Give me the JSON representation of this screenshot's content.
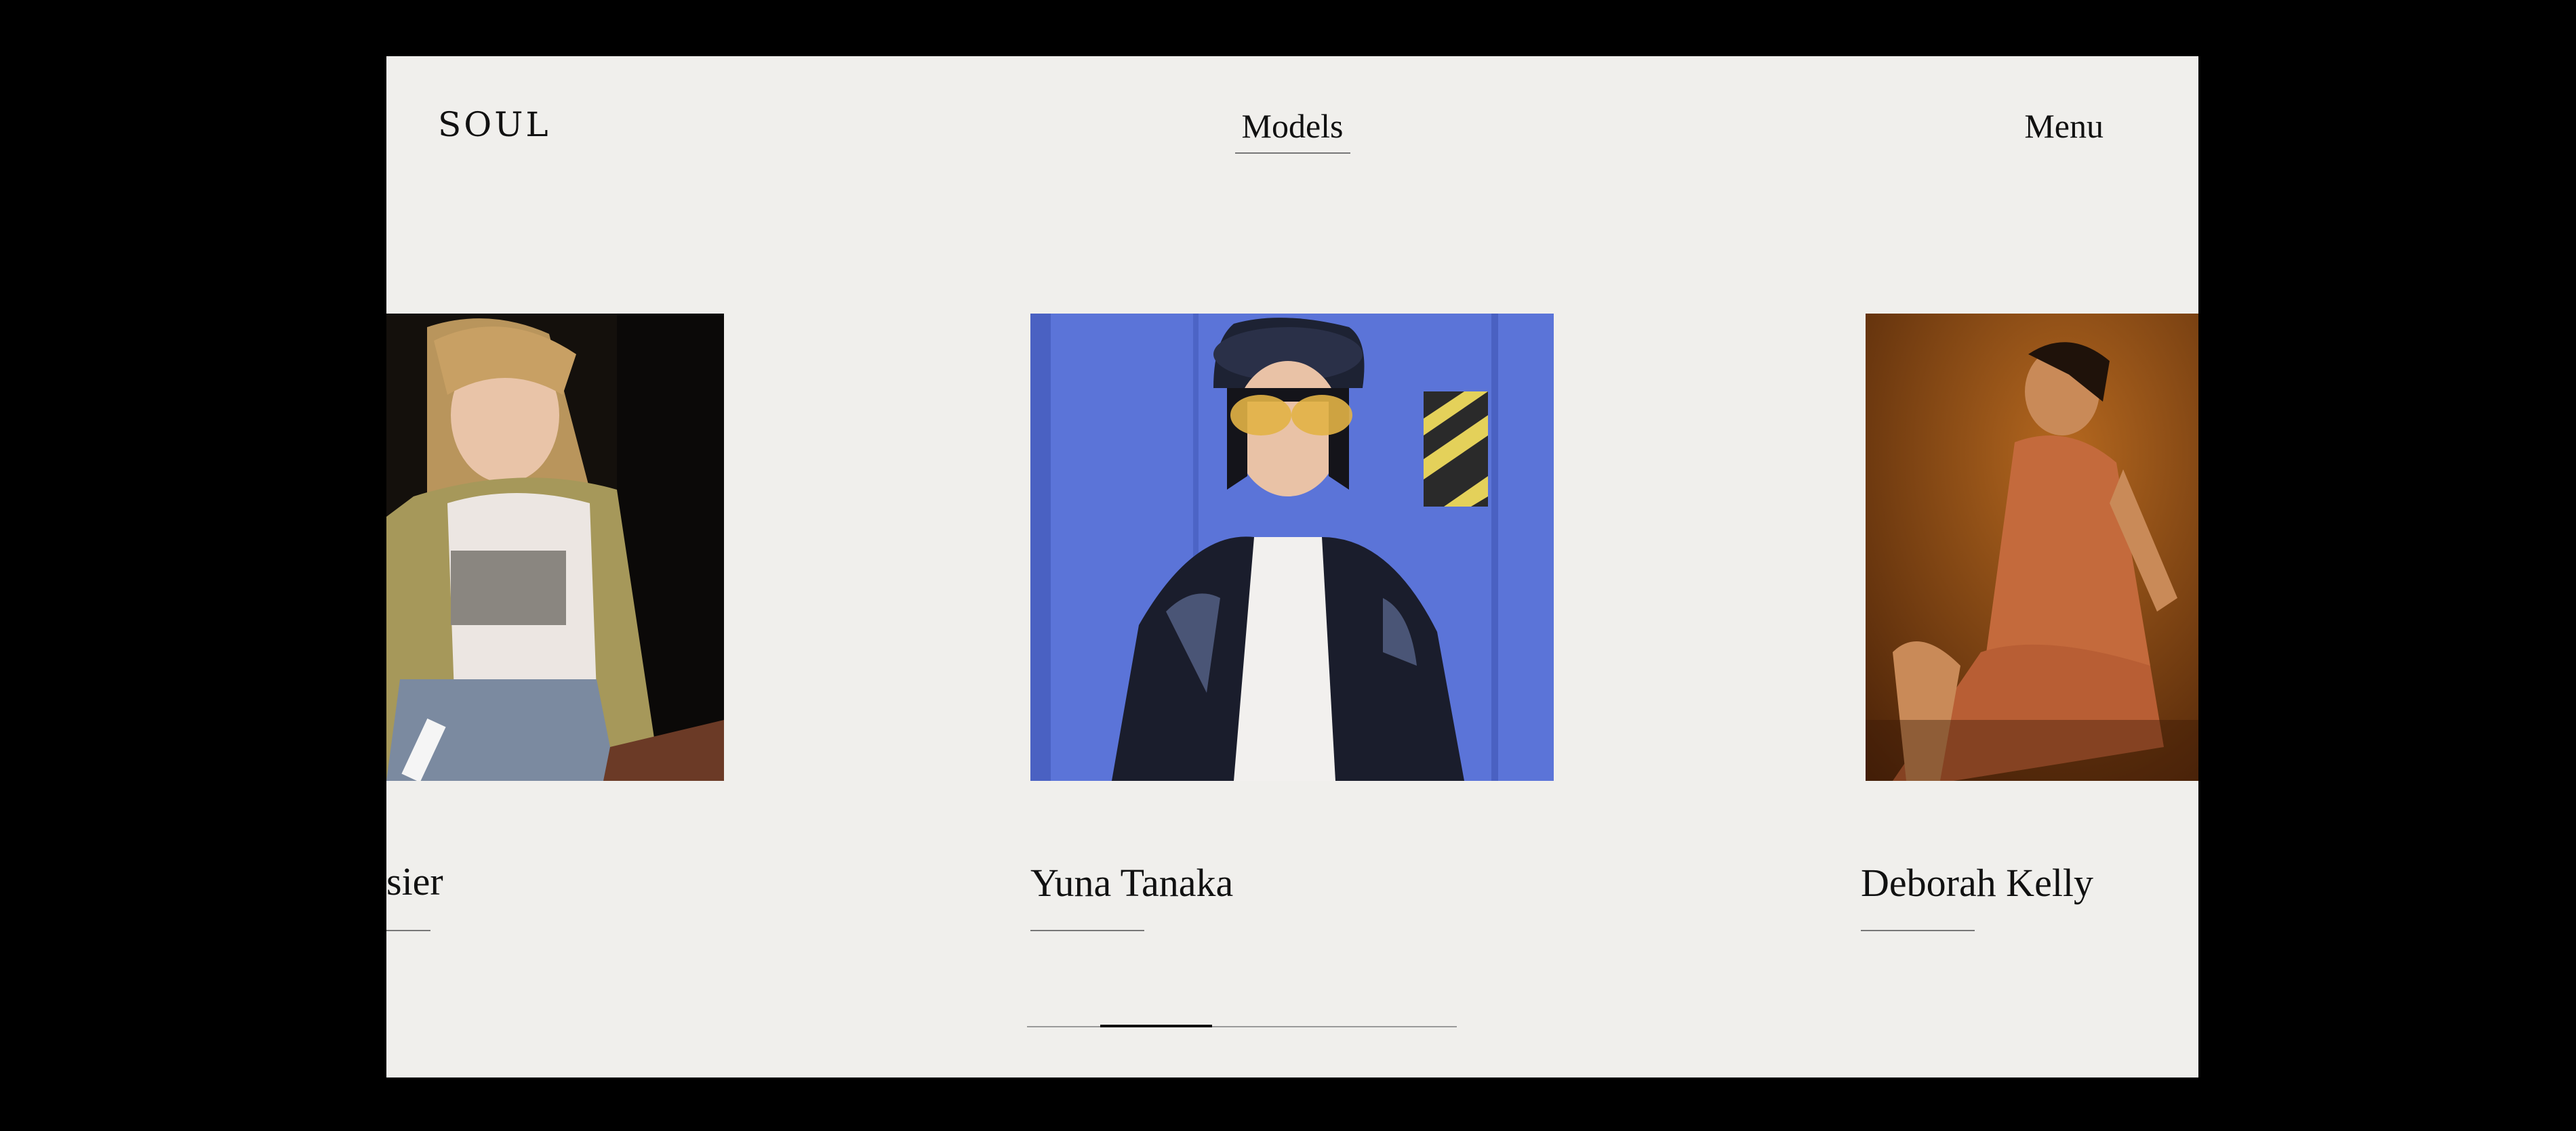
{
  "header": {
    "logo": "SOUL",
    "nav_active": "Models",
    "menu_label": "Menu"
  },
  "models": [
    {
      "name": "sier",
      "photo": "portrait of model with blonde bangs in fur jacket"
    },
    {
      "name": "Yuna Tanaka",
      "photo": "portrait of model in patent cap and yellow sunglasses against blue wall"
    },
    {
      "name": "Deborah Kelly",
      "photo": "portrait of model in orange dress on orange background"
    }
  ],
  "slider": {
    "segment_start": 0.17,
    "segment_end": 0.43
  },
  "colors": {
    "page_background": "#f0efec",
    "frame": "#000000",
    "text": "#111111",
    "rule": "#777777"
  }
}
